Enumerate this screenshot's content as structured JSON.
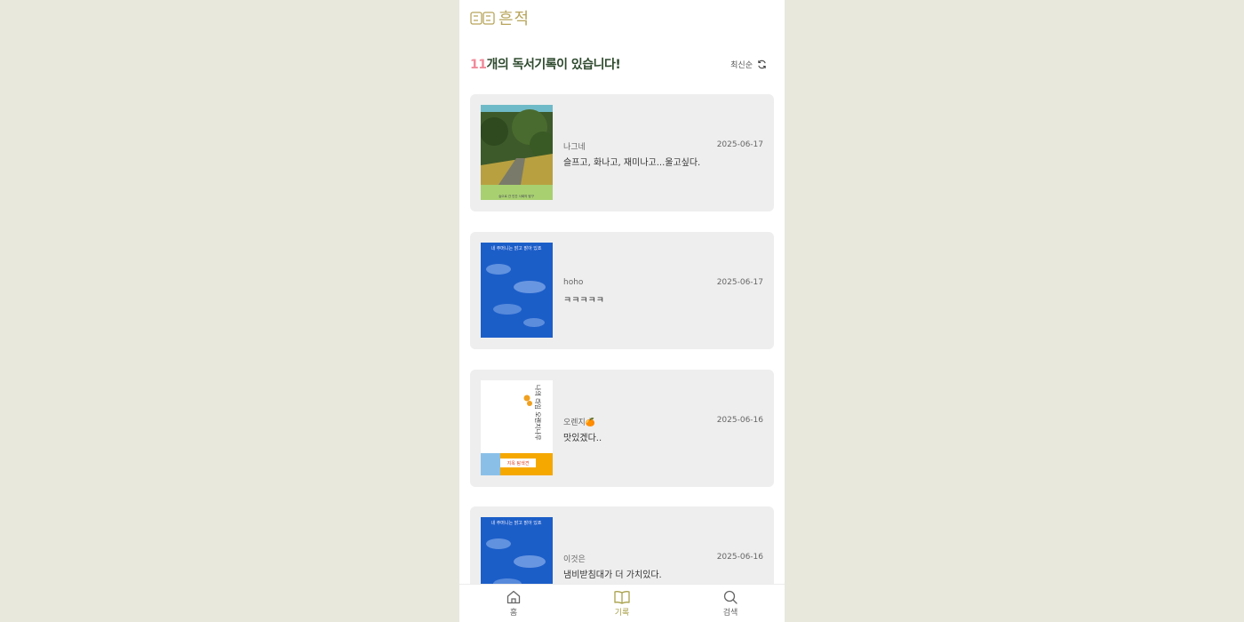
{
  "app": {
    "logo_text": "흔적"
  },
  "header": {
    "count": "11",
    "count_suffix": "개의 독서기록이 있습니다!",
    "sort_label": "최신순"
  },
  "records": [
    {
      "user": "나그네",
      "date": "2025-06-17",
      "text": "슬프고, 화나고, 재미나고...울고싶다.",
      "cover": "forest"
    },
    {
      "user": "hoho",
      "date": "2025-06-17",
      "text": "ㅋㅋㅋㅋㅋ",
      "cover": "sky"
    },
    {
      "user": "오렌지🍊",
      "date": "2025-06-16",
      "text": "맛있겠다..",
      "cover": "orange"
    },
    {
      "user": "이것은",
      "date": "2025-06-16",
      "text": "냄비받침대가 더 가치있다.",
      "cover": "sky"
    }
  ],
  "cover_texts": {
    "forest_top": "숲으로 간 인간 사회의 탐구",
    "sky_title": "내 주머니는 맑고 밝아 있죠",
    "orange_title": "나의 라임 오렌지나무",
    "orange_band": "지옥 탐색견"
  },
  "nav": {
    "home": "홈",
    "records": "기록",
    "search": "검색"
  },
  "colors": {
    "accent": "#a8a14a",
    "count_highlight": "#f08a9a",
    "title": "#2e4a2e",
    "card_bg": "#eeeeee",
    "page_bg": "#e8e8dc"
  }
}
